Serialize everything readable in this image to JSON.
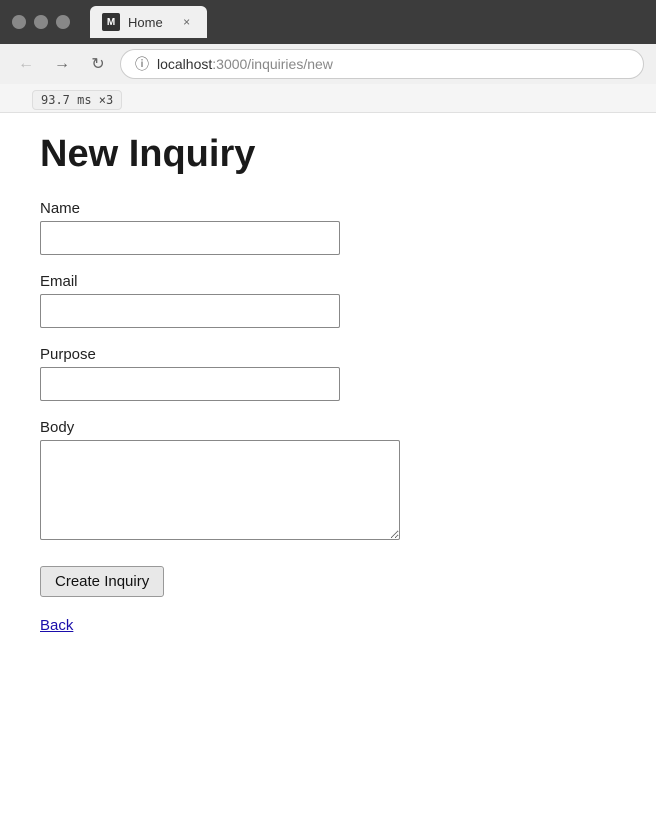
{
  "browser": {
    "tab_title": "Home",
    "tab_logo": "M",
    "close_label": "×",
    "url": "localhost:3000/inquiries/new",
    "url_prefix": "localhost",
    "url_path": ":3000/inquiries/new"
  },
  "perf": {
    "badge": "93.7 ms ×3"
  },
  "page": {
    "title": "New Inquiry",
    "fields": [
      {
        "id": "name",
        "label": "Name",
        "type": "text",
        "placeholder": ""
      },
      {
        "id": "email",
        "label": "Email",
        "type": "text",
        "placeholder": ""
      },
      {
        "id": "purpose",
        "label": "Purpose",
        "type": "text",
        "placeholder": ""
      },
      {
        "id": "body",
        "label": "Body",
        "type": "textarea",
        "placeholder": ""
      }
    ],
    "submit_label": "Create Inquiry",
    "back_label": "Back"
  }
}
